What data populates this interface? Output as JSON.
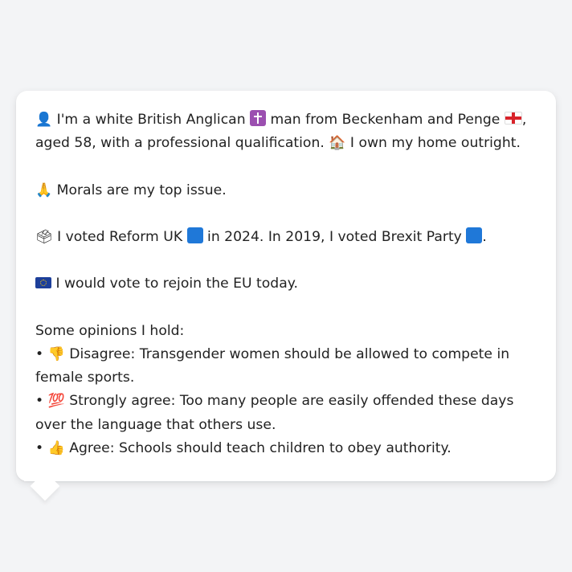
{
  "identity": {
    "icon": "person-silhouette-icon",
    "t1": "I'm a white British Anglican",
    "religion_icon": "latin-cross-icon",
    "t2": "man from Beckenham and Penge",
    "flag_icon": "england-flag-icon",
    "t3": ", aged 58, with a professional qualification.",
    "home_icon": "house-icon",
    "t4": "I own my home outright."
  },
  "issue": {
    "icon": "folded-hands-icon",
    "text": "Morals are my top issue."
  },
  "vote": {
    "icon": "ballot-box-icon",
    "t1": "I voted Reform UK",
    "party_2024_icon": "blue-square-icon",
    "t2": "in 2024. In 2019, I voted Brexit Party",
    "party_2019_icon": "blue-square-icon",
    "t3": "."
  },
  "eu": {
    "icon": "eu-flag-icon",
    "text": "I would vote to rejoin the EU today."
  },
  "opinions": {
    "heading": "Some opinions I hold:",
    "items": [
      {
        "bullet": "•",
        "icon": "thumbs-down-icon",
        "text": "Disagree: Transgender women should be allowed to compete in female sports."
      },
      {
        "bullet": "•",
        "icon": "hundred-points-icon",
        "text": "Strongly agree: Too many people are easily offended these days over the language that others use."
      },
      {
        "bullet": "•",
        "icon": "thumbs-up-icon",
        "text": "Agree: Schools should teach children to obey authority."
      }
    ]
  },
  "colors": {
    "background": "#f3f4f6",
    "bubble": "#ffffff",
    "text": "#222222",
    "party_blue": "#1f78d8",
    "religion_purple": "#9b4fb0"
  }
}
